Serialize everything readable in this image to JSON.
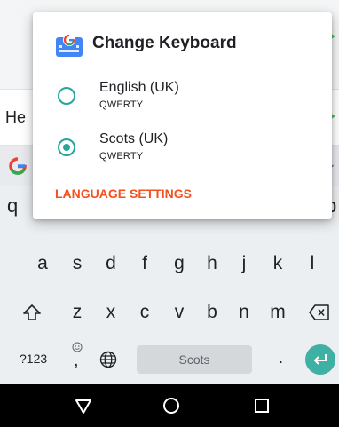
{
  "app": {
    "message_text": "He"
  },
  "dialog": {
    "title": "Change Keyboard",
    "options": [
      {
        "label": "English (UK)",
        "layout": "QWERTY",
        "selected": false
      },
      {
        "label": "Scots (UK)",
        "layout": "QWERTY",
        "selected": true
      }
    ],
    "language_settings_label": "LANGUAGE SETTINGS"
  },
  "keyboard": {
    "row1_visible": [
      "q",
      "p"
    ],
    "row2": [
      "a",
      "s",
      "d",
      "f",
      "g",
      "h",
      "j",
      "k",
      "l"
    ],
    "row3": [
      "z",
      "x",
      "c",
      "v",
      "b",
      "n",
      "m"
    ],
    "symbols_label": "?123",
    "comma_label": ",",
    "period_label": ".",
    "space_label": "Scots"
  },
  "colors": {
    "accent_teal": "#26a69a",
    "accent_orange": "#f4511e",
    "send_green": "#5cb85c"
  },
  "icons": {
    "shift": "shift-icon",
    "backspace": "backspace-icon",
    "globe": "globe-icon",
    "emoji": "emoji-icon",
    "enter": "enter-icon",
    "back": "nav-back-icon",
    "home": "nav-home-icon",
    "recents": "nav-recents-icon"
  }
}
